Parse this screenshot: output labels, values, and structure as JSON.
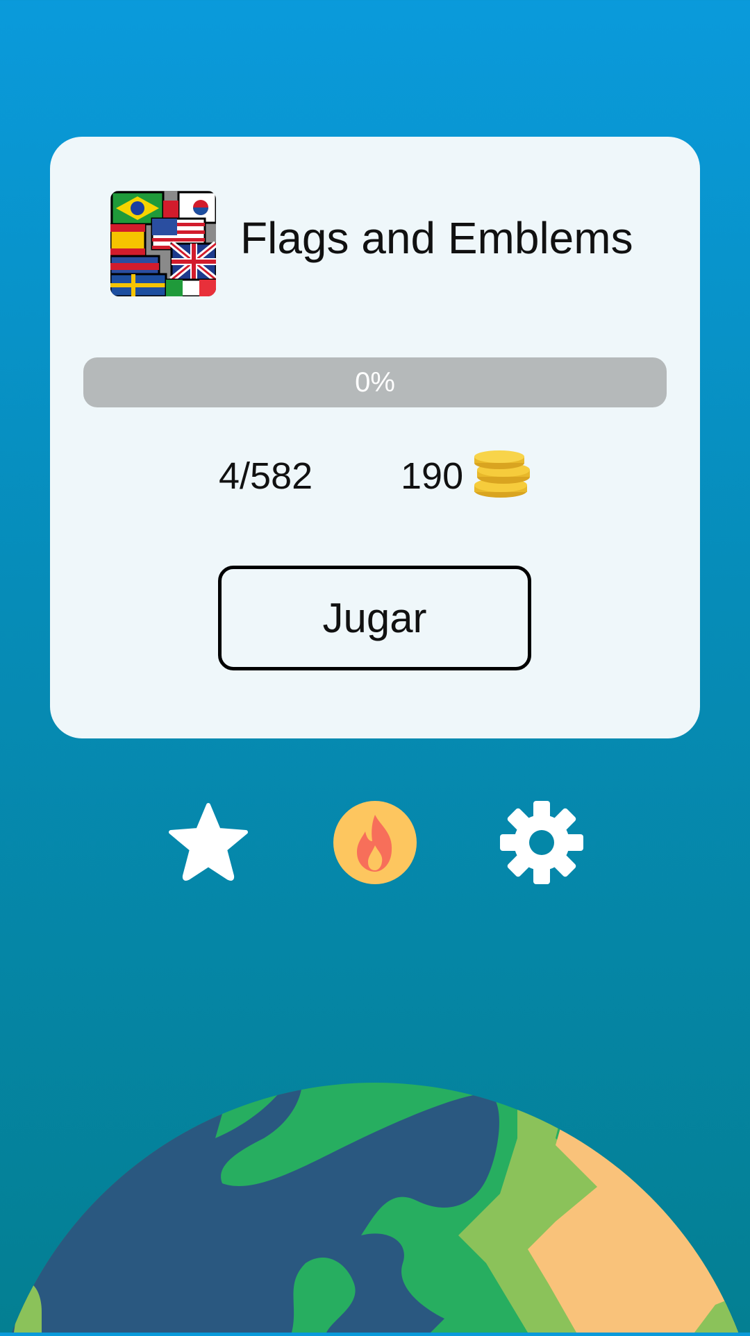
{
  "header": {
    "title": "Flags and Emblems"
  },
  "progress": {
    "value": 0,
    "label": "0%"
  },
  "stats": {
    "count": "4/582",
    "coins": "190"
  },
  "actions": {
    "play_label": "Jugar"
  },
  "icons": [
    "flags-logo-icon",
    "coins-icon",
    "star-icon",
    "fire-icon",
    "gear-icon",
    "earth-illustration"
  ],
  "colors": {
    "background_top": "#0a9adb",
    "background_bottom": "#047f92",
    "card": "#eff7fa",
    "progress_track": "#b5b9ba",
    "coin": "#f4c430",
    "fire_circle": "#fdc65f",
    "earth_ocean": "#2a5880",
    "earth_land": "#27ae60",
    "earth_light_land": "#8bc25a",
    "earth_desert": "#f9c27a"
  }
}
